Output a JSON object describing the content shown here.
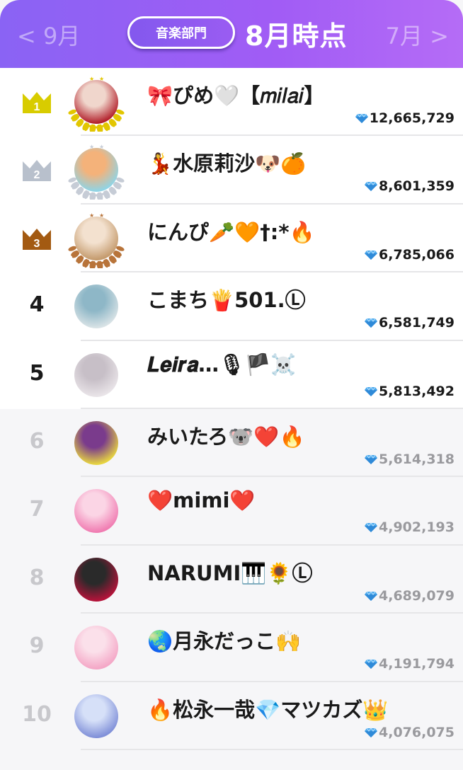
{
  "header": {
    "prev_label": "< 9月",
    "next_label": "7月 >",
    "dept_label": "音楽部門",
    "title": "8月時点"
  },
  "colors": {
    "gold": "#d8cc00",
    "silver": "#b8c0cc",
    "bronze": "#a35a12",
    "accent": "#9a5cf2"
  },
  "ranking": [
    {
      "rank": "1",
      "name": "🎀ぴめ🤍【𝑚𝑖𝑙𝑎𝑖】",
      "score": "12,665,729",
      "avatar_colors": [
        "#b21f2a",
        "#f0d6cc"
      ]
    },
    {
      "rank": "2",
      "name": "💃水原莉沙🐶🍊",
      "score": "8,601,359",
      "avatar_colors": [
        "#8fd4e6",
        "#f4b27a"
      ]
    },
    {
      "rank": "3",
      "name": "にんぴ🥕🧡†:*🔥",
      "score": "6,785,066",
      "avatar_colors": [
        "#c49a6c",
        "#f3e1cf"
      ]
    },
    {
      "rank": "4",
      "name": "こまち🍟501.Ⓛ",
      "score": "6,581,749",
      "avatar_colors": [
        "#d9e3e6",
        "#8eb7c7"
      ]
    },
    {
      "rank": "5",
      "name": "𝑳𝒆𝒊𝒓𝒂…🎙🏴☠️",
      "score": "5,813,492",
      "avatar_colors": [
        "#e9e4e8",
        "#c7bfc7"
      ]
    },
    {
      "rank": "6",
      "name": "みいたろ🐨❤️🔥",
      "score": "5,614,318",
      "avatar_colors": [
        "#e8d640",
        "#7a3b8c"
      ]
    },
    {
      "rank": "7",
      "name": "❤️mimi❤️",
      "score": "4,902,193",
      "avatar_colors": [
        "#f07bb1",
        "#fbd5e5"
      ]
    },
    {
      "rank": "8",
      "name": "NARUMI🎹🌻Ⓛ",
      "score": "4,689,079",
      "avatar_colors": [
        "#b6133a",
        "#2a2a2a"
      ]
    },
    {
      "rank": "9",
      "name": "🌏月永だっこ🙌",
      "score": "4,191,794",
      "avatar_colors": [
        "#f4a6c6",
        "#fbe0ea"
      ]
    },
    {
      "rank": "10",
      "name": "🔥松永一哉💎マツカズ👑",
      "score": "4,076,075",
      "avatar_colors": [
        "#7f8fd8",
        "#d6e0f8"
      ]
    }
  ]
}
